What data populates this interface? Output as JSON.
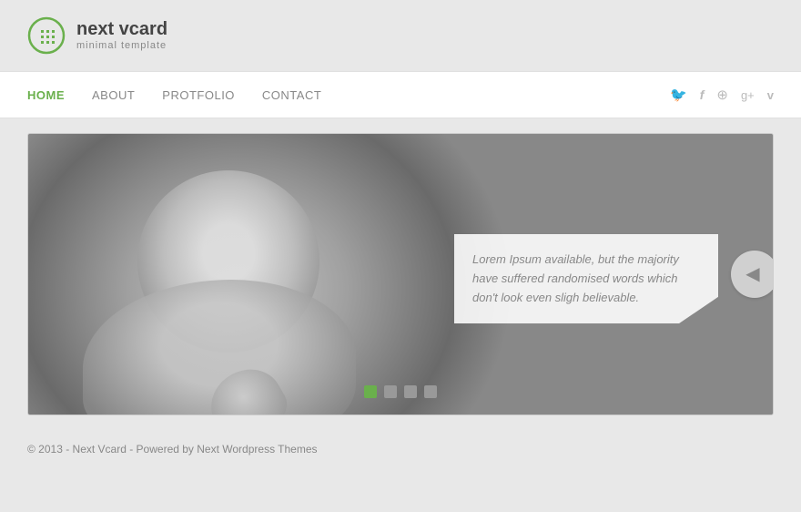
{
  "logo": {
    "title": "next vcard",
    "subtitle": "minimal template"
  },
  "nav": {
    "links": [
      {
        "label": "HOME",
        "active": true
      },
      {
        "label": "ABOUT",
        "active": false
      },
      {
        "label": "PROTFOLIO",
        "active": false
      },
      {
        "label": "CONTACT",
        "active": false
      }
    ],
    "social": [
      "twitter-icon",
      "facebook-icon",
      "dribbble-icon",
      "googleplus-icon",
      "vimeo-icon"
    ]
  },
  "slider": {
    "caption": "Lorem Ipsum available, but the majority have suffered randomised words which don't look even sligh believable.",
    "dots": [
      {
        "active": true
      },
      {
        "active": false
      },
      {
        "active": false
      },
      {
        "active": false
      }
    ],
    "arrow_symbol": "◀"
  },
  "footer": {
    "text": "© 2013 - Next Vcard - Powered by Next Wordpress Themes"
  }
}
